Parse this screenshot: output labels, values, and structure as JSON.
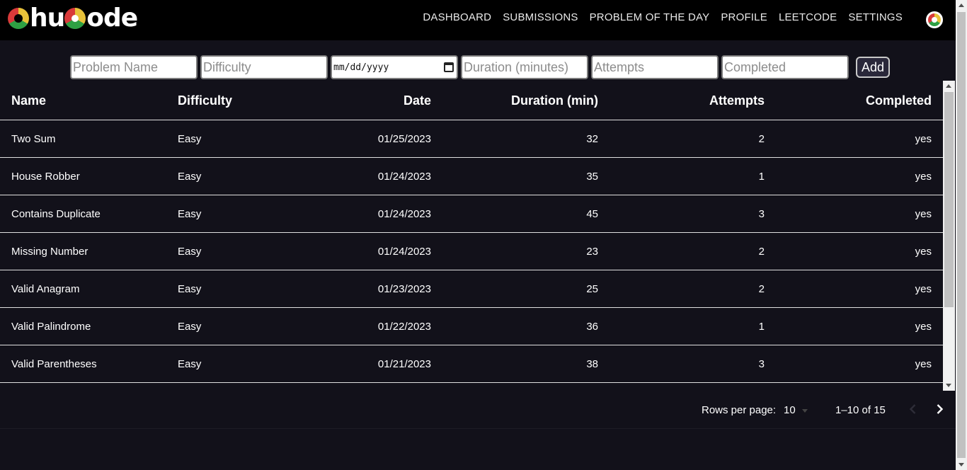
{
  "app": {
    "logo_parts": [
      "C",
      "hu",
      "C",
      "ode"
    ],
    "accent_colors": {
      "yellow": "#e8c23a",
      "green": "#2ea043",
      "red": "#d93a3a",
      "background": "#12111a",
      "navbar": "#000000"
    }
  },
  "nav": {
    "links": [
      "DASHBOARD",
      "SUBMISSIONS",
      "PROBLEM OF THE DAY",
      "PROFILE",
      "LEETCODE",
      "SETTINGS"
    ],
    "avatar_icon": "avatar-icon"
  },
  "form": {
    "name_placeholder": "Problem Name",
    "difficulty_placeholder": "Difficulty",
    "date_placeholder": "mm/dd/yyyy",
    "duration_placeholder": "Duration (minutes)",
    "attempts_placeholder": "Attempts",
    "completed_placeholder": "Completed",
    "add_label": "Add"
  },
  "table": {
    "columns": [
      "Name",
      "Difficulty",
      "Date",
      "Duration (min)",
      "Attempts",
      "Completed"
    ],
    "rows": [
      [
        "Two Sum",
        "Easy",
        "01/25/2023",
        "32",
        "2",
        "yes"
      ],
      [
        "House Robber",
        "Easy",
        "01/24/2023",
        "35",
        "1",
        "yes"
      ],
      [
        "Contains Duplicate",
        "Easy",
        "01/24/2023",
        "45",
        "3",
        "yes"
      ],
      [
        "Missing Number",
        "Easy",
        "01/24/2023",
        "23",
        "2",
        "yes"
      ],
      [
        "Valid Anagram",
        "Easy",
        "01/23/2023",
        "25",
        "2",
        "yes"
      ],
      [
        "Valid Palindrome",
        "Easy",
        "01/22/2023",
        "36",
        "1",
        "yes"
      ],
      [
        "Valid Parentheses",
        "Easy",
        "01/21/2023",
        "38",
        "3",
        "yes"
      ]
    ]
  },
  "pagination": {
    "rows_per_page_label": "Rows per page:",
    "rows_per_page_value": "10",
    "range_text": "1–10 of 15",
    "prev_icon": "chevron-left-icon",
    "next_icon": "chevron-right-icon"
  }
}
